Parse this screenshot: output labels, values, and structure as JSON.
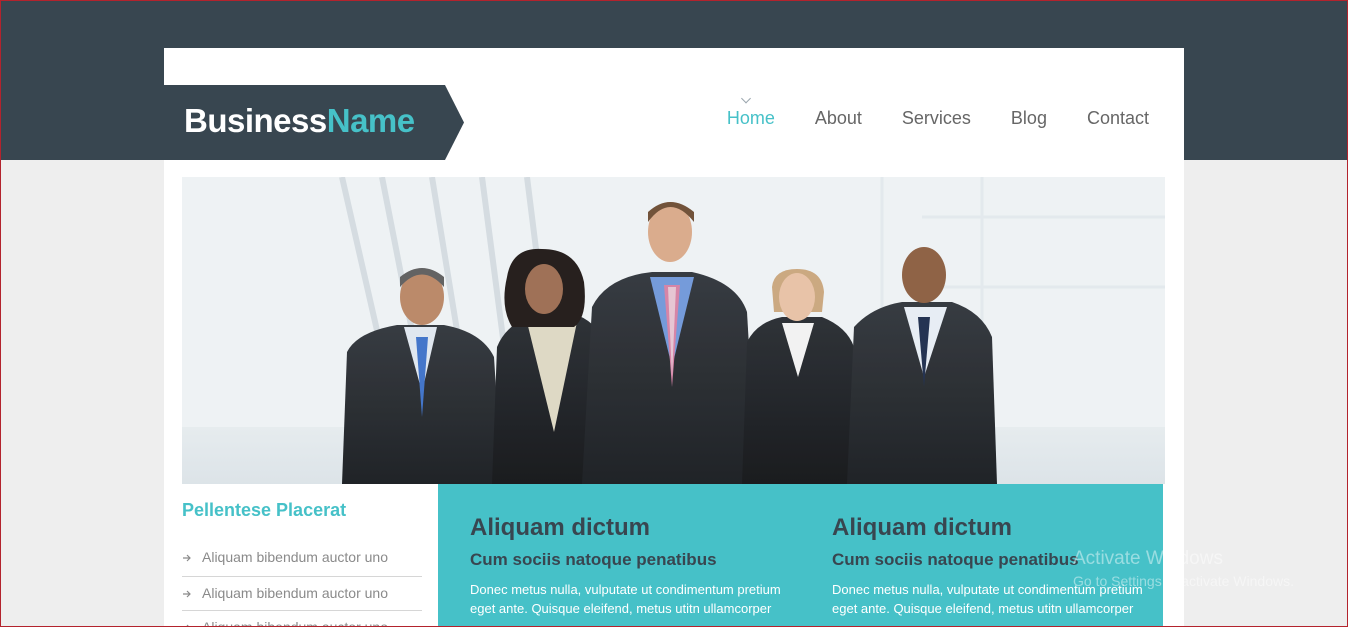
{
  "brand": {
    "name_part1": "Business",
    "name_part2": "Name"
  },
  "colors": {
    "header_dark": "#384650",
    "accent_teal": "#46c1c8",
    "nav_text": "#666666",
    "sidebar_text": "#8a8a8a",
    "page_bg": "#eeeeee"
  },
  "nav": {
    "items": [
      {
        "label": "Home",
        "active": true
      },
      {
        "label": "About",
        "active": false
      },
      {
        "label": "Services",
        "active": false
      },
      {
        "label": "Blog",
        "active": false
      },
      {
        "label": "Contact",
        "active": false
      }
    ]
  },
  "hero": {
    "image": "group-of-five-business-people-photo"
  },
  "sidebar": {
    "title": "Pellentese Placerat",
    "items": [
      {
        "label": "Aliquam bibendum auctor uno",
        "icon": "arrow-right-icon"
      },
      {
        "label": "Aliquam bibendum auctor uno",
        "icon": "arrow-right-icon"
      },
      {
        "label": "Aliquam bibendum auctor uno",
        "icon": "arrow-right-icon"
      }
    ]
  },
  "features": [
    {
      "heading": "Aliquam dictum",
      "subheading": "Cum sociis natoque penatibus",
      "body": "Donec metus nulla, vulputate ut condimentum pretium eget ante. Quisque eleifend, metus utitn ullamcorper"
    },
    {
      "heading": "Aliquam dictum",
      "subheading": "Cum sociis natoque penatibus",
      "body": "Donec metus nulla, vulputate ut condimentum pretium eget ante. Quisque eleifend, metus utitn ullamcorper"
    }
  ],
  "watermark": {
    "title": "Activate Windows",
    "subtitle": "Go to Settings to activate Windows."
  }
}
